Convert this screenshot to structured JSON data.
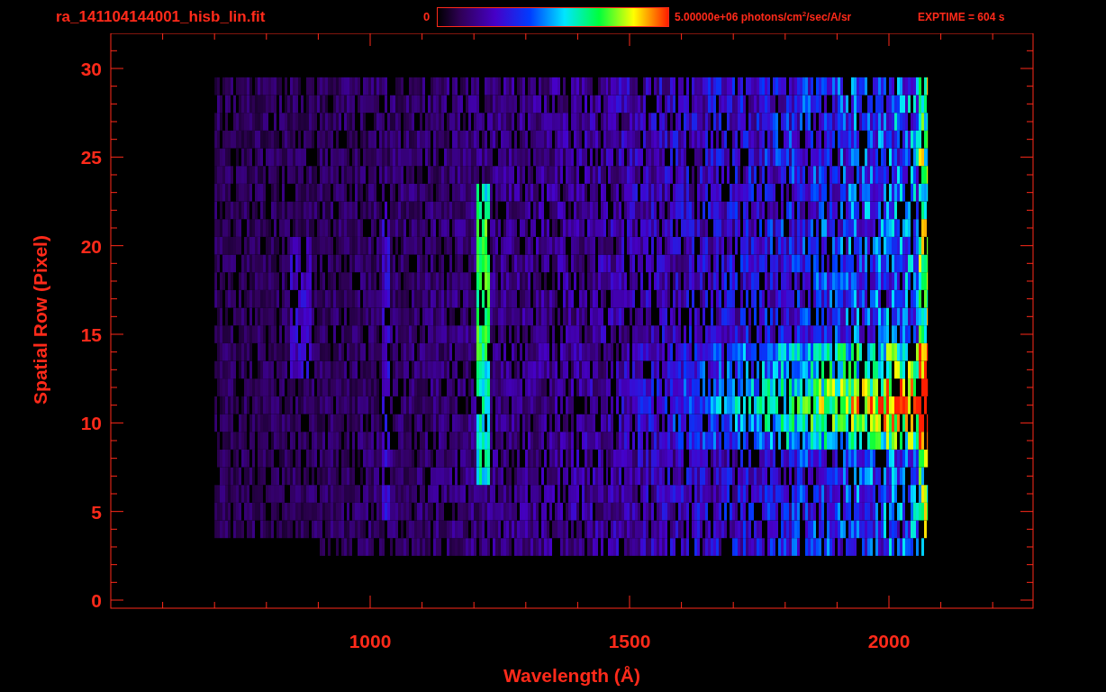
{
  "header": {
    "title": "ra_141104144001_hisb_lin.fit",
    "colorbar": {
      "min_label": "0",
      "max_label": "5.00000e+06 photons/cm$^{2}$/sec/A/sr"
    },
    "exposure": "EXPTIME = 604 s"
  },
  "plot": {
    "xlabel": "Wavelength (Å)",
    "ylabel": "Spatial Row (Pixel)",
    "xticks": [
      "1000",
      "1500",
      "2000"
    ],
    "yticks": [
      "30",
      "25",
      "20",
      "15",
      "10",
      "5",
      "0"
    ]
  }
}
